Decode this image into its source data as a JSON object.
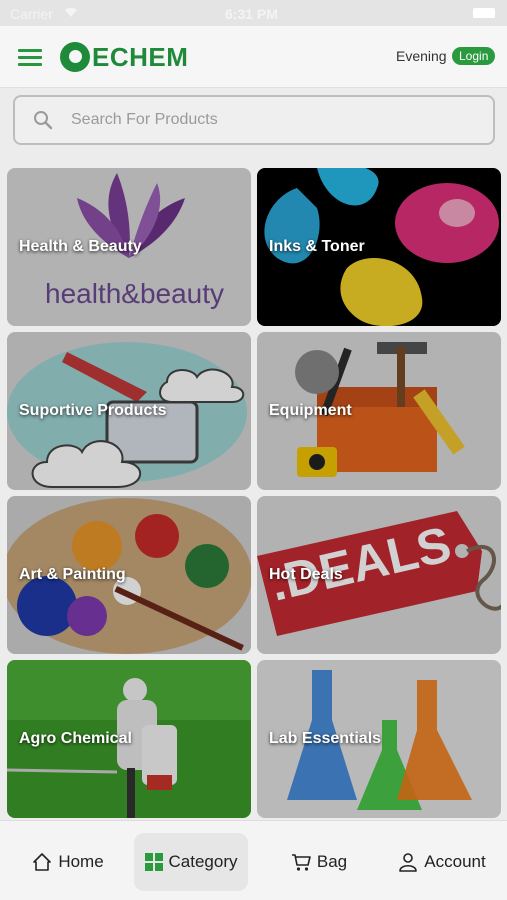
{
  "status_bar": {
    "carrier": "Carrier",
    "time": "6:31 PM"
  },
  "header": {
    "logo_text": "ECHEM",
    "greeting": "Evening",
    "login_label": "Login",
    "brand_color": "#1f8a3a"
  },
  "search": {
    "placeholder": "Search For Products"
  },
  "categories": [
    {
      "label": "Health & Beauty"
    },
    {
      "label": "Inks & Toner"
    },
    {
      "label": "Suportive Products"
    },
    {
      "label": "Equipment"
    },
    {
      "label": "Art & Painting"
    },
    {
      "label": "Hot Deals"
    },
    {
      "label": "Agro Chemical"
    },
    {
      "label": "Lab Essentials"
    }
  ],
  "card_art_text": {
    "health": "health&beauty",
    "deals": ".DEALS"
  },
  "tab_bar": {
    "home": "Home",
    "category": "Category",
    "bag": "Bag",
    "account": "Account",
    "active": "category"
  }
}
